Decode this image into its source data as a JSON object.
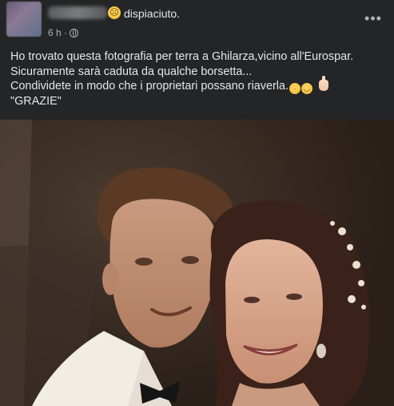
{
  "post": {
    "feeling_emoji_name": "sad-face-icon",
    "feeling_text": "dispiaciuto.",
    "timestamp": "6 h",
    "separator": "·",
    "privacy_icon_name": "globe-icon",
    "more_icon_name": "more-horizontal-icon",
    "more_glyph": "•••",
    "text_lines": [
      "Ho trovato questa fotografia per terra a Ghilarza,vicino all'Eurospar.",
      "Sicuramente sarà caduta da qualche borsetta...",
      "Condividete in modo che i proprietari possano riaverla.",
      "\"GRAZIE\""
    ],
    "line3_emojis": [
      "sad-relieved-face-icon",
      "smiling-face-icon",
      "raised-hand-icon"
    ],
    "photo_icon_name": "couple-photograph"
  },
  "colors": {
    "background": "#242526",
    "text_primary": "#e4e6eb",
    "text_secondary": "#b0b3b8"
  }
}
